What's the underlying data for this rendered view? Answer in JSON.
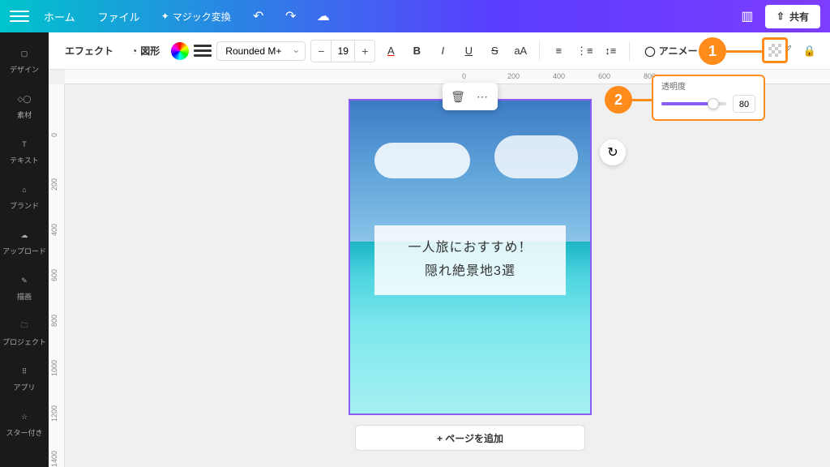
{
  "topbar": {
    "home": "ホーム",
    "file": "ファイル",
    "magic": "マジック変換",
    "share": "共有"
  },
  "toolbar": {
    "effect": "エフェクト",
    "shape": "図形",
    "font": "Rounded M+",
    "size": "19",
    "animate": "アニメー"
  },
  "sidebar": {
    "items": [
      {
        "label": "デザイン"
      },
      {
        "label": "素材"
      },
      {
        "label": "テキスト"
      },
      {
        "label": "ブランド"
      },
      {
        "label": "アップロード"
      },
      {
        "label": "描画"
      },
      {
        "label": "プロジェクト"
      },
      {
        "label": "アプリ"
      },
      {
        "label": "スター付き"
      }
    ]
  },
  "ruler_h": {
    "t0": "0",
    "t200": "200",
    "t400": "400",
    "t600": "600",
    "t800": "800"
  },
  "ruler_v": {
    "t0": "0",
    "t200": "200",
    "t400": "400",
    "t600": "600",
    "t800": "800",
    "t1000": "1000",
    "t1200": "1200",
    "t1400": "1400"
  },
  "canvas": {
    "text_line1": "一人旅におすすめ！",
    "text_line2": "隠れ絶景地3選",
    "add_page": "+ ページを追加"
  },
  "transparency": {
    "label": "透明度",
    "value": "80"
  },
  "callouts": {
    "c1": "1",
    "c2": "2"
  }
}
